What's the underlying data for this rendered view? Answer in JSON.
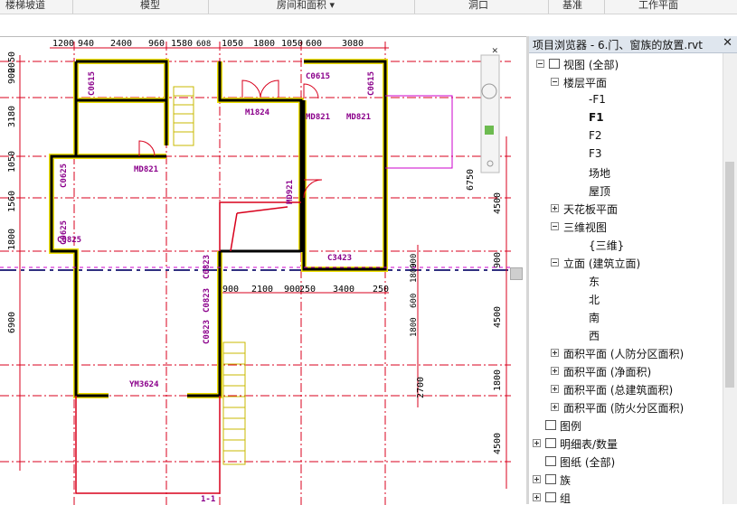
{
  "ribbon": {
    "panels": [
      "楼梯坡道",
      "模型",
      "房间和面积 ▾",
      "洞口",
      "基准",
      "工作平面"
    ]
  },
  "drawing": {
    "dims_top": [
      "1200",
      "940",
      "2400",
      "960",
      "1580",
      "608",
      "1050",
      "1800",
      "1050",
      "600",
      "3080"
    ],
    "dims_mid": [
      "900",
      "2100",
      "900",
      "250",
      "3400",
      "250"
    ],
    "dims_left": [
      "900",
      "2050",
      "3180",
      "1050",
      "1560",
      "1800",
      "6900"
    ],
    "dims_right": [
      "6750",
      "4500",
      "900",
      "4500",
      "1800",
      "4500",
      "2700",
      "1800",
      "600",
      "1800",
      "900"
    ],
    "tags": [
      "C0615",
      "C0615",
      "C0615",
      "C0615",
      "MD821",
      "MD821",
      "MD821",
      "MD921",
      "MD921",
      "M1824",
      "C0625",
      "C0625",
      "C0825",
      "C0823",
      "C0823",
      "C0823",
      "C3423",
      "YM3624",
      "1-1",
      "1-1"
    ]
  },
  "browser": {
    "title": "项目浏览器 - 6.门、窗族的放置.rvt",
    "close": "✕",
    "items": [
      {
        "label": "视图 (全部)",
        "toggle": "minus",
        "icon": true
      },
      {
        "label": "楼层平面",
        "toggle": "minus"
      },
      {
        "label": "-F1"
      },
      {
        "label": "F1",
        "bold": true
      },
      {
        "label": "F2"
      },
      {
        "label": "F3"
      },
      {
        "label": "场地"
      },
      {
        "label": "屋顶"
      },
      {
        "label": "天花板平面",
        "toggle": "plus"
      },
      {
        "label": "三维视图",
        "toggle": "minus"
      },
      {
        "label": "{三维}"
      },
      {
        "label": "立面 (建筑立面)",
        "toggle": "minus"
      },
      {
        "label": "东"
      },
      {
        "label": "北"
      },
      {
        "label": "南"
      },
      {
        "label": "西"
      },
      {
        "label": "面积平面 (人防分区面积)",
        "toggle": "plus"
      },
      {
        "label": "面积平面 (净面积)",
        "toggle": "plus"
      },
      {
        "label": "面积平面 (总建筑面积)",
        "toggle": "plus"
      },
      {
        "label": "面积平面 (防火分区面积)",
        "toggle": "plus"
      },
      {
        "label": "图例",
        "icon": true
      },
      {
        "label": "明细表/数量",
        "toggle": "plus",
        "icon": true
      },
      {
        "label": "图纸 (全部)",
        "icon": true
      },
      {
        "label": "族",
        "toggle": "plus",
        "icon": true
      },
      {
        "label": "组",
        "toggle": "plus",
        "icon": true
      }
    ]
  },
  "colors": {
    "wall": "#000000",
    "wall_highlight": "#f0e100",
    "grid": "#d8001c",
    "annotation": "#8b008b",
    "browser_header": "#dfe6ee"
  }
}
